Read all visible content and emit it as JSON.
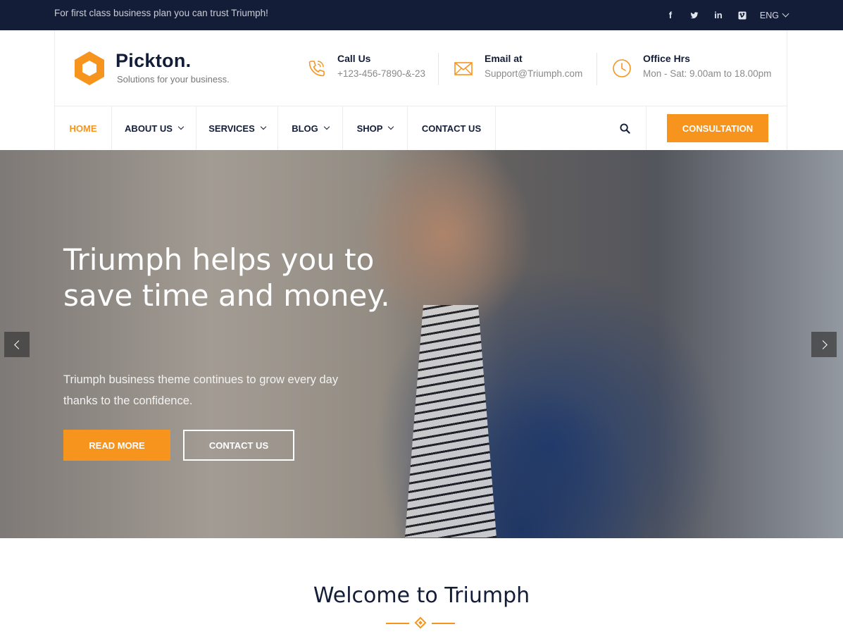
{
  "topbar": {
    "tagline": "For first class business plan you can trust Triumph!",
    "socials": [
      {
        "icon": "facebook-icon",
        "glyph": "f"
      },
      {
        "icon": "twitter-icon",
        "glyph": "t"
      },
      {
        "icon": "linkedin-icon",
        "glyph": "in"
      },
      {
        "icon": "vimeo-icon",
        "glyph": "v"
      }
    ],
    "language": "ENG"
  },
  "brand": {
    "name": "Pickton.",
    "slogan": "Solutions for your business."
  },
  "contacts": [
    {
      "icon": "phone-icon",
      "label": "Call Us",
      "value": "+123-456-7890-&-23"
    },
    {
      "icon": "envelope-icon",
      "label": "Email at",
      "value": "Support@Triumph.com"
    },
    {
      "icon": "clock-icon",
      "label": "Office Hrs",
      "value": "Mon - Sat: 9.00am to 18.00pm"
    }
  ],
  "nav": {
    "items": [
      {
        "label": "HOME",
        "active": true,
        "dropdown": false
      },
      {
        "label": "ABOUT US",
        "active": false,
        "dropdown": true
      },
      {
        "label": "SERVICES",
        "active": false,
        "dropdown": true
      },
      {
        "label": "BLOG",
        "active": false,
        "dropdown": true
      },
      {
        "label": "SHOP",
        "active": false,
        "dropdown": true
      },
      {
        "label": "CONTACT US",
        "active": false,
        "dropdown": false
      }
    ],
    "search_icon": "search-icon",
    "cta": "CONSULTATION"
  },
  "hero": {
    "headline": "Triumph helps you to save time and money.",
    "subtext": "Triumph business theme continues to grow every day thanks to the confidence.",
    "primary_button": "READ MORE",
    "secondary_button": "CONTACT US"
  },
  "welcome": {
    "title": "Welcome to Triumph"
  },
  "colors": {
    "accent": "#f7941d",
    "navy": "#141d38"
  }
}
